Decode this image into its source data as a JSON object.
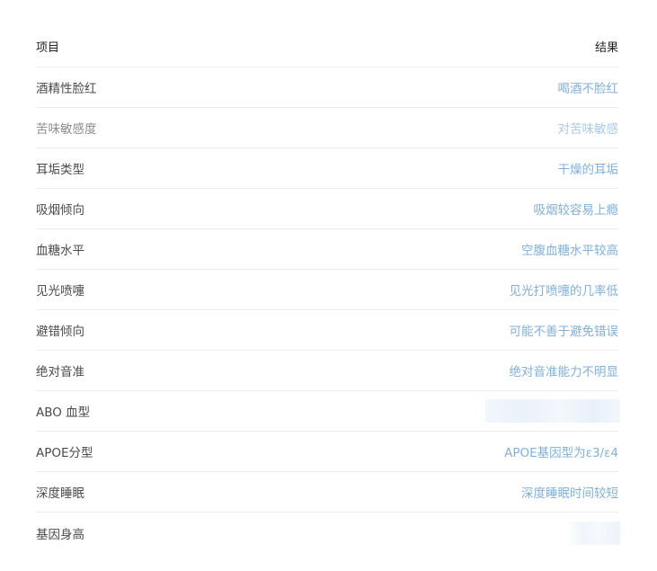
{
  "header": {
    "item_label": "项目",
    "result_label": "结果"
  },
  "rows": [
    {
      "item": "酒精性脸红",
      "result": "喝酒不脸红"
    },
    {
      "item": "苦味敏感度",
      "result": "对苦味敏感"
    },
    {
      "item": "耳垢类型",
      "result": "干燥的耳垢"
    },
    {
      "item": "吸烟倾向",
      "result": "吸烟较容易上瘾"
    },
    {
      "item": "血糖水平",
      "result": "空腹血糖水平较高"
    },
    {
      "item": "见光喷嚏",
      "result": "见光打喷嚏的几率低"
    },
    {
      "item": "避错倾向",
      "result": "可能不善于避免错误"
    },
    {
      "item": "绝对音准",
      "result": "绝对音准能力不明显"
    },
    {
      "item": "ABO 血型",
      "result": ""
    },
    {
      "item": "APOE分型",
      "result": "APOE基因型为ε3/ε4"
    },
    {
      "item": "深度睡眠",
      "result": "深度睡眠时间较短"
    },
    {
      "item": "基因身高",
      "result": ""
    }
  ],
  "colors": {
    "result_text": "#7fb0dc",
    "item_text": "#4a4a4a",
    "divider": "#ececec"
  }
}
